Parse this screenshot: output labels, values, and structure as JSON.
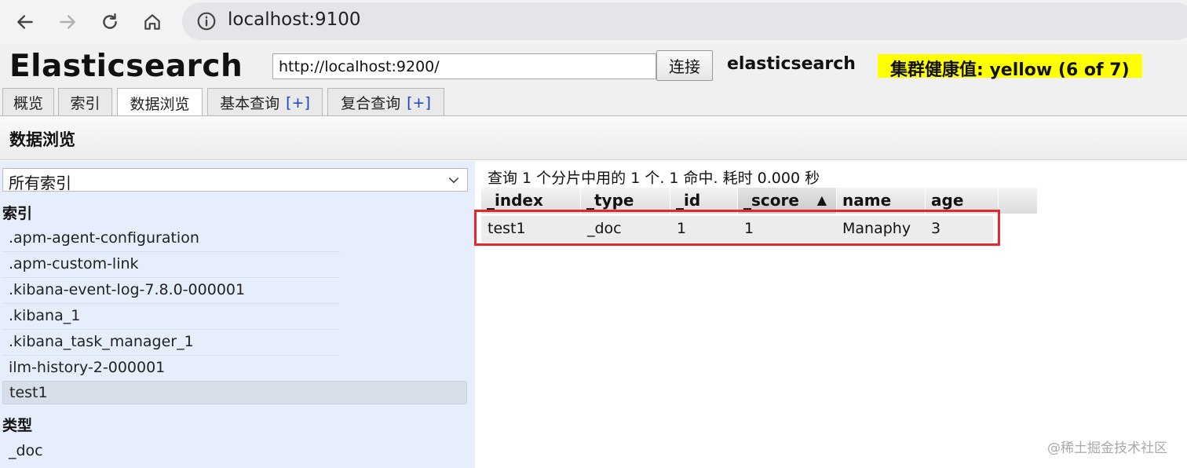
{
  "browser": {
    "url": "localhost:9100"
  },
  "header": {
    "app_title": "Elasticsearch",
    "connection_url": "http://localhost:9200/",
    "connect_label": "连接",
    "cluster_name": "elasticsearch",
    "health_text": "集群健康值: yellow (6 of 7)",
    "health_color": "#ffff00"
  },
  "tabs": [
    {
      "label": "概览",
      "plus": ""
    },
    {
      "label": "索引",
      "plus": ""
    },
    {
      "label": "数据浏览",
      "plus": ""
    },
    {
      "label": "基本查询",
      "plus": "[+]"
    },
    {
      "label": "复合查询",
      "plus": "[+]"
    }
  ],
  "active_tab": "数据浏览",
  "section": {
    "title": "数据浏览"
  },
  "sidebar": {
    "select_value": "所有索引",
    "indices_heading": "索引",
    "indices": [
      ".apm-agent-configuration",
      ".apm-custom-link",
      ".kibana-event-log-7.8.0-000001",
      ".kibana_1",
      ".kibana_task_manager_1",
      "ilm-history-2-000001",
      "test1"
    ],
    "selected_index": "test1",
    "types_heading": "类型",
    "types": [
      "_doc"
    ]
  },
  "results": {
    "summary": "查询 1 个分片中用的 1 个. 1 命中. 耗时 0.000 秒",
    "columns": [
      "_index",
      "_type",
      "_id",
      "_score",
      "name",
      "age"
    ],
    "sorted_column": "_score",
    "sort_arrow": "▲",
    "rows": [
      [
        "test1",
        "_doc",
        "1",
        "1",
        "Manaphy",
        "3"
      ]
    ],
    "highlight_color": "#e8262b"
  },
  "watermark": "@稀土掘金技术社区"
}
